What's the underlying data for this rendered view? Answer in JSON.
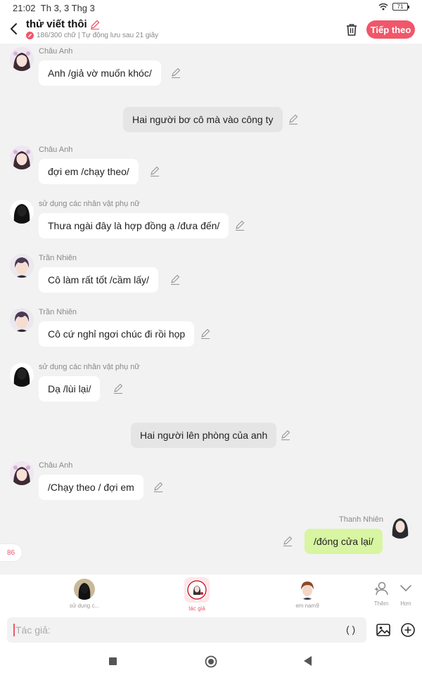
{
  "status": {
    "time": "21:02",
    "date": "Th 3, 3 Thg 3",
    "battery": "71"
  },
  "header": {
    "title": "thử viết thôi",
    "subtitle": "186/300 chữ | Tự động lưu sau 21 giây",
    "next_label": "Tiếp theo"
  },
  "messages": [
    {
      "sender": "Châu Anh",
      "text": "Anh /giả vờ muốn khóc/"
    },
    {
      "text": "Hai người bơ cô mà vào công ty"
    },
    {
      "sender": "Châu Anh",
      "text": "đợi em /chạy theo/"
    },
    {
      "sender": "sử dụng các nhân vật phụ nữ",
      "text": "Thưa ngài đây là hợp đồng ạ /đưa đến/"
    },
    {
      "sender": "Trần Nhiên",
      "text": "Cô làm rất tốt /cầm lấy/"
    },
    {
      "sender": "Trần Nhiên",
      "text": "Cô cứ nghỉ ngơi chúc đi rồi họp"
    },
    {
      "sender": "sử dụng các nhân vật phụ nữ",
      "text": "Dạ /lùi lại/"
    },
    {
      "text": "Hai người lên phòng của anh"
    },
    {
      "sender": "Châu Anh",
      "text": "/Chạy theo / đợi em"
    },
    {
      "sender": "Thanh Nhiên",
      "text": "/đóng cửa lại/"
    }
  ],
  "counter": "86",
  "characters": [
    {
      "label": "sử dụng c..."
    },
    {
      "label": "tác giả"
    },
    {
      "label": "em nam9"
    }
  ],
  "tools": {
    "add_label": "Thêm",
    "more_label": "Hơn"
  },
  "input": {
    "placeholder": "Tác giả:",
    "paren": "( )"
  },
  "colors": {
    "accent": "#f0576a",
    "my_bubble": "#d8f5a2",
    "narration_bubble": "#e5e5e5",
    "background": "#f2f2f2"
  }
}
